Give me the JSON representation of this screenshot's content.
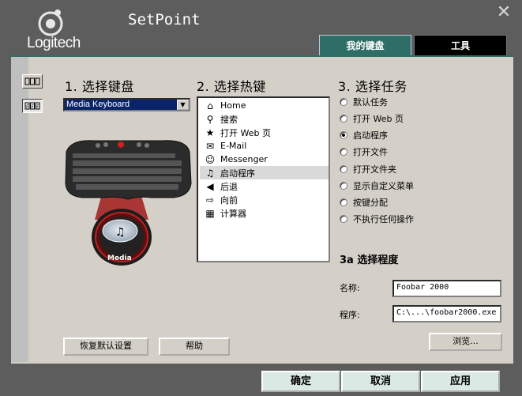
{
  "header": {
    "brand": "Logitech",
    "app_title": "SetPoint",
    "close_glyph": "✕",
    "tabs": [
      {
        "label": "我的键盘",
        "active": true
      },
      {
        "label": "工具",
        "active": false
      }
    ]
  },
  "section1": {
    "title": "1. 选择键盘",
    "keyboard_value": "Media Keyboard",
    "media_key_label": "Media"
  },
  "section2": {
    "title": "2. 选择热键",
    "items": [
      {
        "icon": "home-icon",
        "glyph": "⌂",
        "label": "Home"
      },
      {
        "icon": "search-icon",
        "glyph": "⚲",
        "label": "搜索"
      },
      {
        "icon": "star-icon",
        "glyph": "★",
        "label": "打开 Web 页"
      },
      {
        "icon": "mail-icon",
        "glyph": "✉",
        "label": "E-Mail"
      },
      {
        "icon": "messenger-icon",
        "glyph": "☺",
        "label": "Messenger"
      },
      {
        "icon": "music-note-icon",
        "glyph": "♫",
        "label": "启动程序",
        "selected": true
      },
      {
        "icon": "back-arrow-icon",
        "glyph": "◀",
        "label": "后退"
      },
      {
        "icon": "forward-arrow-icon",
        "glyph": "⇨",
        "label": "向前"
      },
      {
        "icon": "calculator-icon",
        "glyph": "▦",
        "label": "计算器"
      }
    ]
  },
  "section3": {
    "title": "3. 选择任务",
    "options": [
      {
        "label": "默认任务",
        "checked": false
      },
      {
        "label": "打开 Web 页",
        "checked": false
      },
      {
        "label": "启动程序",
        "checked": true
      },
      {
        "label": "打开文件",
        "checked": false
      },
      {
        "label": "打开文件夹",
        "checked": false
      },
      {
        "label": "显示自定义菜单",
        "checked": false
      },
      {
        "label": "按键分配",
        "checked": false
      },
      {
        "label": "不执行任何操作",
        "checked": false
      }
    ]
  },
  "section3a": {
    "title": "3a 选择程度",
    "name_label": "名称:",
    "name_value": "Foobar 2000",
    "program_label": "程序:",
    "program_value": "C:\\...\\foobar2000.exe",
    "browse_label": "浏览..."
  },
  "buttons": {
    "restore_defaults": "恢复默认设置",
    "help": "帮助",
    "ok": "确定",
    "cancel": "取消",
    "apply": "应用"
  },
  "colors": {
    "accent_teal": "#2f6e66",
    "panel_bg": "#d4d0c8",
    "window_bg": "#5d5d5d",
    "selection_blue": "#0a246a"
  }
}
